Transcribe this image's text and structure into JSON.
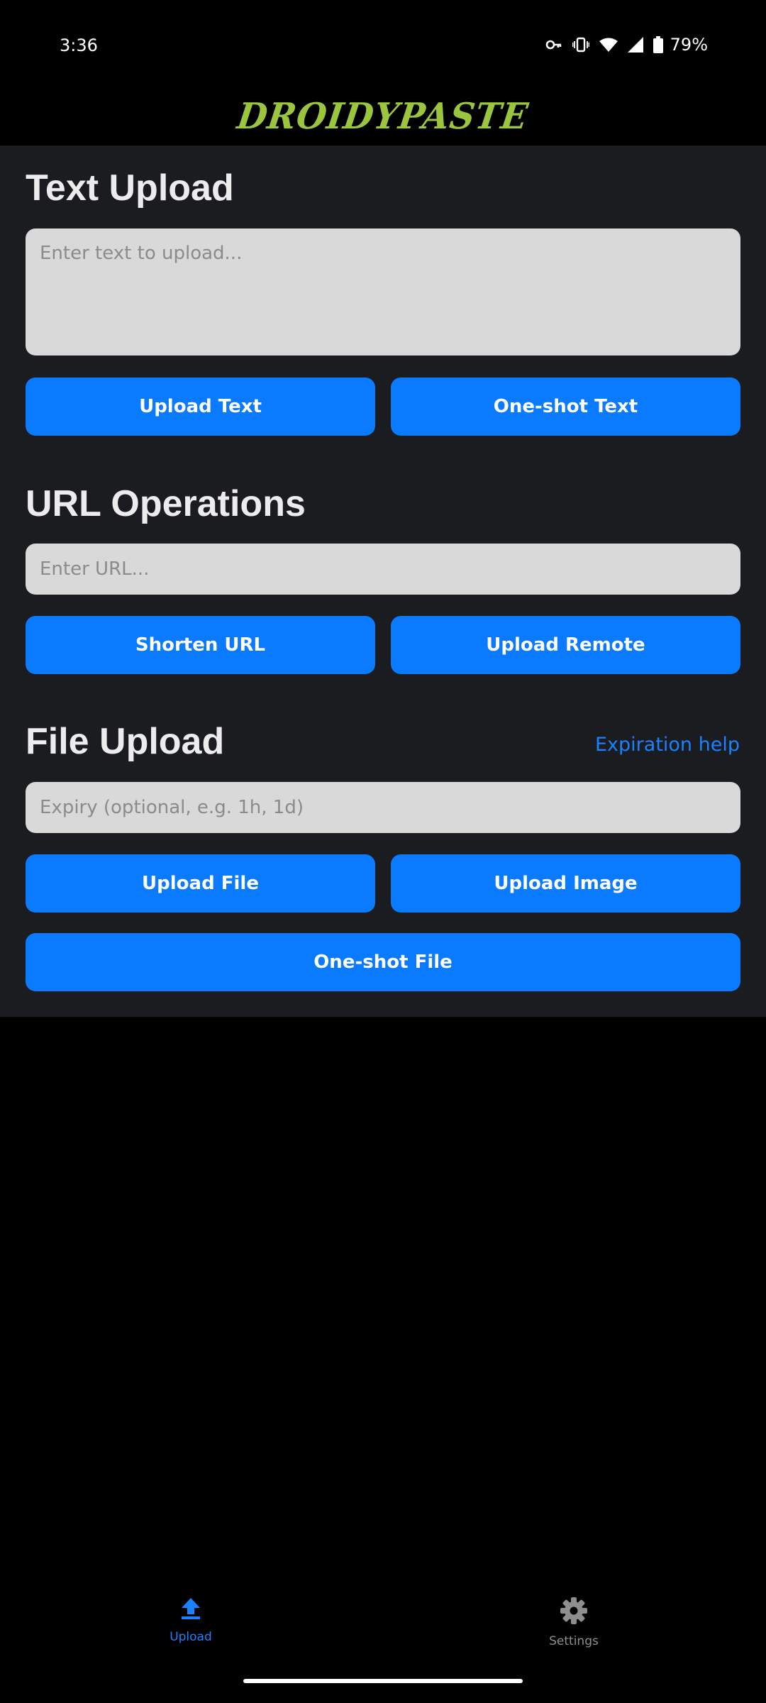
{
  "status_bar": {
    "time": "3:36",
    "battery": "79%",
    "icons": [
      "vpn-key-icon",
      "vibrate-icon",
      "wifi-icon",
      "cell-signal-icon",
      "battery-icon"
    ]
  },
  "app": {
    "logo_text": "DROIDYPASTE",
    "logo_color": "#9bc53d"
  },
  "text_upload": {
    "title": "Text Upload",
    "text_value": "",
    "text_placeholder": "Enter text to upload...",
    "upload_label": "Upload Text",
    "oneshot_label": "One-shot Text"
  },
  "url_operations": {
    "title": "URL Operations",
    "url_value": "",
    "url_placeholder": "Enter URL...",
    "shorten_label": "Shorten URL",
    "remote_label": "Upload Remote"
  },
  "file_upload": {
    "title": "File Upload",
    "help_link": "Expiration help",
    "expiry_value": "",
    "expiry_placeholder": "Expiry (optional, e.g. 1h, 1d)",
    "file_label": "Upload File",
    "image_label": "Upload Image",
    "oneshot_label": "One-shot File"
  },
  "bottom_nav": {
    "items": [
      {
        "label": "Upload",
        "icon": "upload-icon",
        "active": true
      },
      {
        "label": "Settings",
        "icon": "gear-icon",
        "active": false
      }
    ]
  },
  "colors": {
    "accent": "#0a7aff",
    "panel_bg": "#1a1c1f",
    "field_bg": "#d9d9d9",
    "active_nav": "#1a82ff",
    "inactive_nav": "#8e8e8e"
  }
}
